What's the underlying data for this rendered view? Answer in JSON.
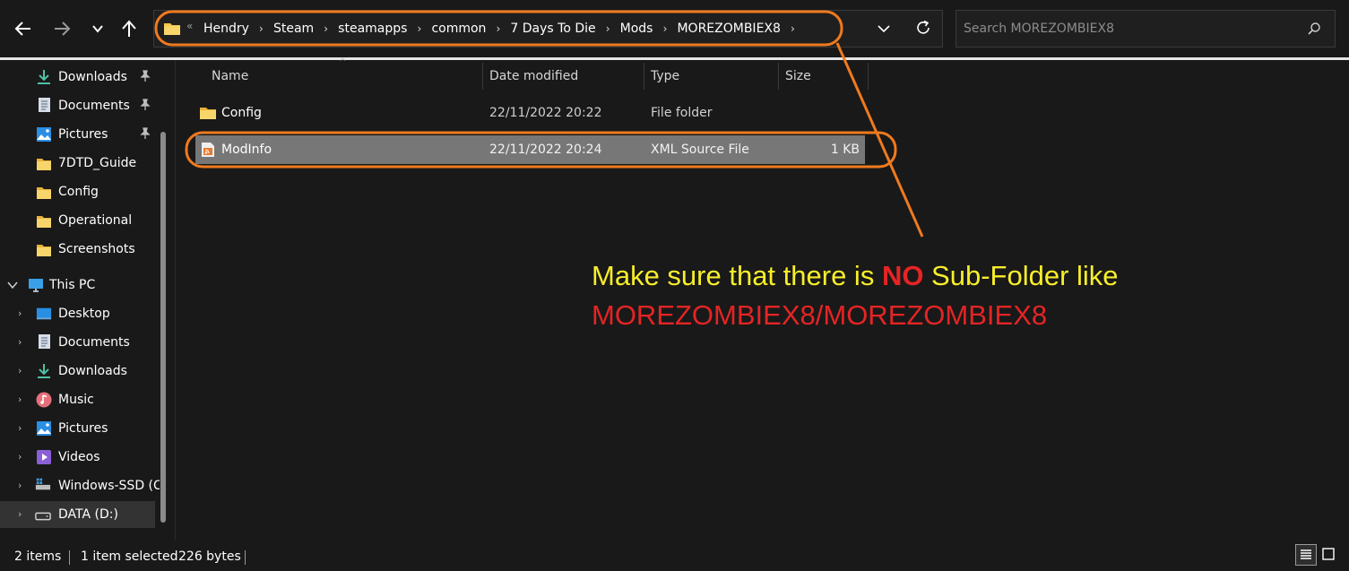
{
  "toolbar": {
    "back_icon": "back-arrow-icon",
    "forward_icon": "forward-arrow-icon",
    "recent_icon": "chevron-down-icon",
    "up_icon": "up-arrow-icon",
    "overflow_chevron": "«",
    "crumb_separator": "›",
    "breadcrumbs": [
      "Hendry",
      "Steam",
      "steamapps",
      "common",
      "7 Days To Die",
      "Mods",
      "MOREZOMBIEX8"
    ],
    "search_placeholder": "Search MOREZOMBIEX8"
  },
  "sidebar": {
    "quick_access": [
      {
        "label": "Downloads",
        "icon": "download-icon",
        "pinned": true
      },
      {
        "label": "Documents",
        "icon": "document-icon",
        "pinned": true
      },
      {
        "label": "Pictures",
        "icon": "pictures-icon",
        "pinned": true
      },
      {
        "label": "7DTD_Guide",
        "icon": "folder-icon",
        "pinned": false
      },
      {
        "label": "Config",
        "icon": "folder-icon",
        "pinned": false
      },
      {
        "label": "Operational",
        "icon": "folder-icon",
        "pinned": false
      },
      {
        "label": "Screenshots",
        "icon": "folder-icon",
        "pinned": false
      }
    ],
    "this_pc": {
      "label": "This PC",
      "icon": "computer-icon",
      "expanded": true
    },
    "this_pc_items": [
      {
        "label": "Desktop",
        "icon": "desktop-icon"
      },
      {
        "label": "Documents",
        "icon": "document-icon"
      },
      {
        "label": "Downloads",
        "icon": "download-icon"
      },
      {
        "label": "Music",
        "icon": "music-icon"
      },
      {
        "label": "Pictures",
        "icon": "pictures-icon"
      },
      {
        "label": "Videos",
        "icon": "videos-icon"
      },
      {
        "label": "Windows-SSD (C",
        "icon": "drive-icon"
      },
      {
        "label": "DATA (D:)",
        "icon": "drive-icon",
        "selected": true
      }
    ]
  },
  "file_list": {
    "columns": {
      "name": "Name",
      "date": "Date modified",
      "type": "Type",
      "size": "Size"
    },
    "rows": [
      {
        "name": "Config",
        "date": "22/11/2022 20:22",
        "type": "File folder",
        "size": "",
        "icon": "folder-icon",
        "selected": false
      },
      {
        "name": "ModInfo",
        "date": "22/11/2022 20:24",
        "type": "XML Source File",
        "size": "1 KB",
        "icon": "xml-file-icon",
        "selected": true
      }
    ]
  },
  "annotation": {
    "line1_a": "Make sure that there is ",
    "line1_b": "NO",
    "line1_c": " Sub-Folder like",
    "line2": "MOREZOMBIEX8/MOREZOMBIEX8",
    "colors": {
      "highlight": "#f07a1e",
      "yellow": "#f7ee2a",
      "red": "#e52424"
    }
  },
  "status": {
    "items": "2 items",
    "selected": "1 item selected",
    "size": "226 bytes",
    "view_details_icon": "details-view-icon",
    "view_tiles_icon": "large-icons-view-icon"
  },
  "colors": {
    "background": "#191919",
    "selection": "#777777",
    "folder": "#f3c54a"
  }
}
